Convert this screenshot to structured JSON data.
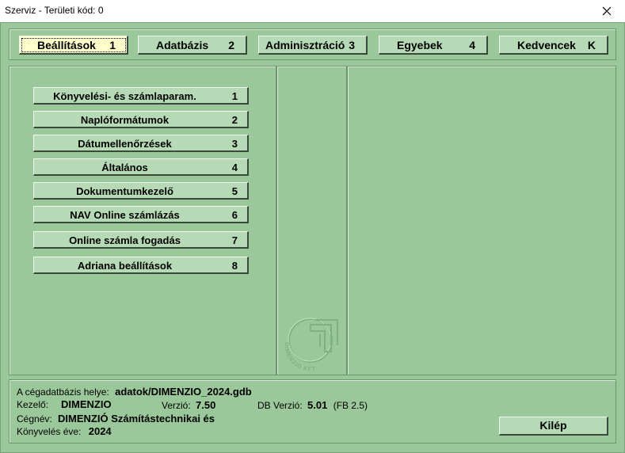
{
  "window": {
    "title": "Szerviz - Területi kód: 0"
  },
  "tabs": [
    {
      "label": "Beállítások",
      "key": "1"
    },
    {
      "label": "Adatbázis",
      "key": "2"
    },
    {
      "label": "Adminisztráció",
      "key": "3"
    },
    {
      "label": "Egyebek",
      "key": "4"
    },
    {
      "label": "Kedvencek",
      "key": "K"
    }
  ],
  "menu": [
    {
      "label": "Könyvelési- és számlaparam.",
      "key": "1"
    },
    {
      "label": "Naplóformátumok",
      "key": "2"
    },
    {
      "label": "Dátumellenőrzések",
      "key": "3"
    },
    {
      "label": "Általános",
      "key": "4"
    },
    {
      "label": "Dokumentumkezelő",
      "key": "5"
    },
    {
      "label": "NAV Online számlázás",
      "key": "6"
    },
    {
      "label": "Online számla fogadás",
      "key": "7"
    },
    {
      "label": "Adriana beállítások",
      "key": "8"
    }
  ],
  "logo": {
    "text": "DIMENZIÓ KFT"
  },
  "info": {
    "db_label": "A cégadatbázis helye:",
    "db_value": "adatok/DIMENZIO_2024.gdb",
    "user_label": "Kezelő:",
    "user_value": "DIMENZIO",
    "version_label": "Verzió:",
    "version_value": "7.50",
    "dbversion_label": "DB Verzió:",
    "dbversion_value": "5.01",
    "dbversion_extra": "(FB 2.5)",
    "company_label": "Cégnév:",
    "company_value": "DIMENZIÓ Számítástechnikai és",
    "year_label": "Könyvelés éve:",
    "year_value": "2024"
  },
  "exit_button": {
    "label": "Kilép"
  },
  "colors": {
    "background": "#9ac89a",
    "button": "#b6dab6",
    "active_tab": "#ffffcc"
  }
}
